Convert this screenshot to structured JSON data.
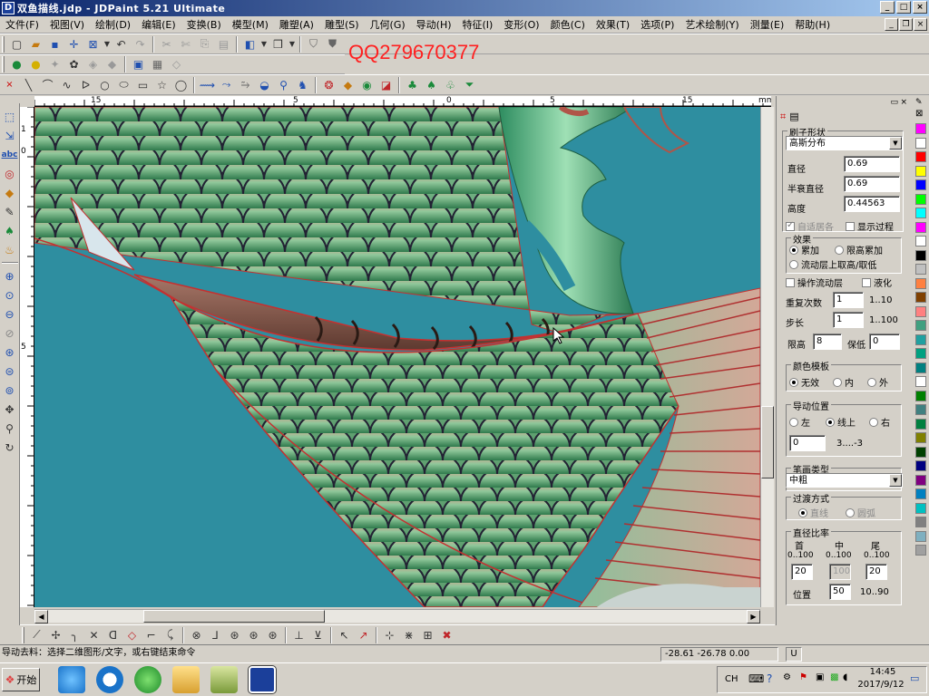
{
  "window": {
    "title": "双鱼描线.jdp - JDPaint 5.21 Ultimate",
    "app_icon": "D",
    "buttons": [
      "_",
      "□",
      "×"
    ]
  },
  "menu": [
    "文件(F)",
    "视图(V)",
    "绘制(D)",
    "编辑(E)",
    "变换(B)",
    "模型(M)",
    "雕塑(A)",
    "雕型(S)",
    "几何(G)",
    "导动(H)",
    "特征(I)",
    "变形(O)",
    "颜色(C)",
    "效果(T)",
    "选项(P)",
    "艺术绘制(Y)",
    "测量(E)",
    "帮助(H)"
  ],
  "menu_ctrls": [
    "_",
    "❐",
    "×"
  ],
  "watermark": "QQ279670377",
  "ruler": {
    "top_labels": [
      "15",
      "5",
      "0",
      "5",
      "15",
      "mm"
    ],
    "left_labels": [
      "1",
      "0",
      "5"
    ]
  },
  "right_panel": {
    "brush_shape_title": "刷子形状",
    "brush_shape_value": "高斯分布",
    "diameter_label": "直径",
    "diameter_value": "0.69",
    "half_diameter_label": "半衰直径",
    "half_diameter_value": "0.69",
    "height_label": "高度",
    "height_value": "0.44563",
    "auto_center_label": "自适居各",
    "show_process_label": "显示过程",
    "effect_title": "效果",
    "effect_accumulate": "累加",
    "effect_limit_accumulate": "限高累加",
    "effect_flow_layer": "流动层上取高/取低",
    "operate_flow_layer": "操作流动层",
    "liquify": "液化",
    "repeat_label": "重复次数",
    "repeat_value": "1",
    "repeat_range": "1..10",
    "step_label": "步长",
    "step_value": "1",
    "step_range": "1..100",
    "limit_height_label": "限高",
    "limit_height_value": "8",
    "keep_low_label": "保低",
    "keep_low_value": "0",
    "color_template_title": "颜色模板",
    "color_none": "无效",
    "color_inside": "内",
    "color_outside": "外",
    "guide_position_title": "导动位置",
    "guide_left": "左",
    "guide_on_line": "线上",
    "guide_right": "右",
    "guide_value": "0",
    "guide_range": "3....-3",
    "pen_type_title": "笔画类型",
    "pen_type_value": "中粗",
    "transition_title": "过渡方式",
    "transition_line": "直线",
    "transition_arc": "圆弧",
    "diameter_ratio_title": "直径比率",
    "ratio_head": "首",
    "ratio_mid": "中",
    "ratio_tail": "尾",
    "ratio_range_head": "0..100",
    "ratio_range_mid": "0..100",
    "ratio_range_tail": "0..100",
    "ratio_head_value": "20",
    "ratio_mid_value": "100",
    "ratio_tail_value": "20",
    "position_label": "位置",
    "position_value": "50",
    "position_range": "10..90"
  },
  "palette_colors": [
    "#ff00ff",
    "#ffffff",
    "#ff0000",
    "#ffff00",
    "#0000ff",
    "#00ff00",
    "#00ffff",
    "#ff00ff",
    "#ffffff",
    "#000000",
    "#c0c0c0",
    "#ff8040",
    "#804000",
    "#ff8080",
    "#40a080",
    "#20a0a0",
    "#00a080",
    "#008080",
    "#ffffff",
    "#008000",
    "#408080",
    "#008040",
    "#808000",
    "#004000",
    "#000080",
    "#800080",
    "#0080c0",
    "#00c0c0",
    "#808080",
    "#7fb0c0",
    "#a0a0a0"
  ],
  "status": {
    "prompt": "导动去料：选择二维图形/文字，或右键结束命令",
    "coords": "-28.61 -26.78 0.00",
    "indicator": "U"
  },
  "taskbar": {
    "start_label": "开始",
    "lang": "CH",
    "time": "14:45",
    "date": "2017/9/12"
  }
}
